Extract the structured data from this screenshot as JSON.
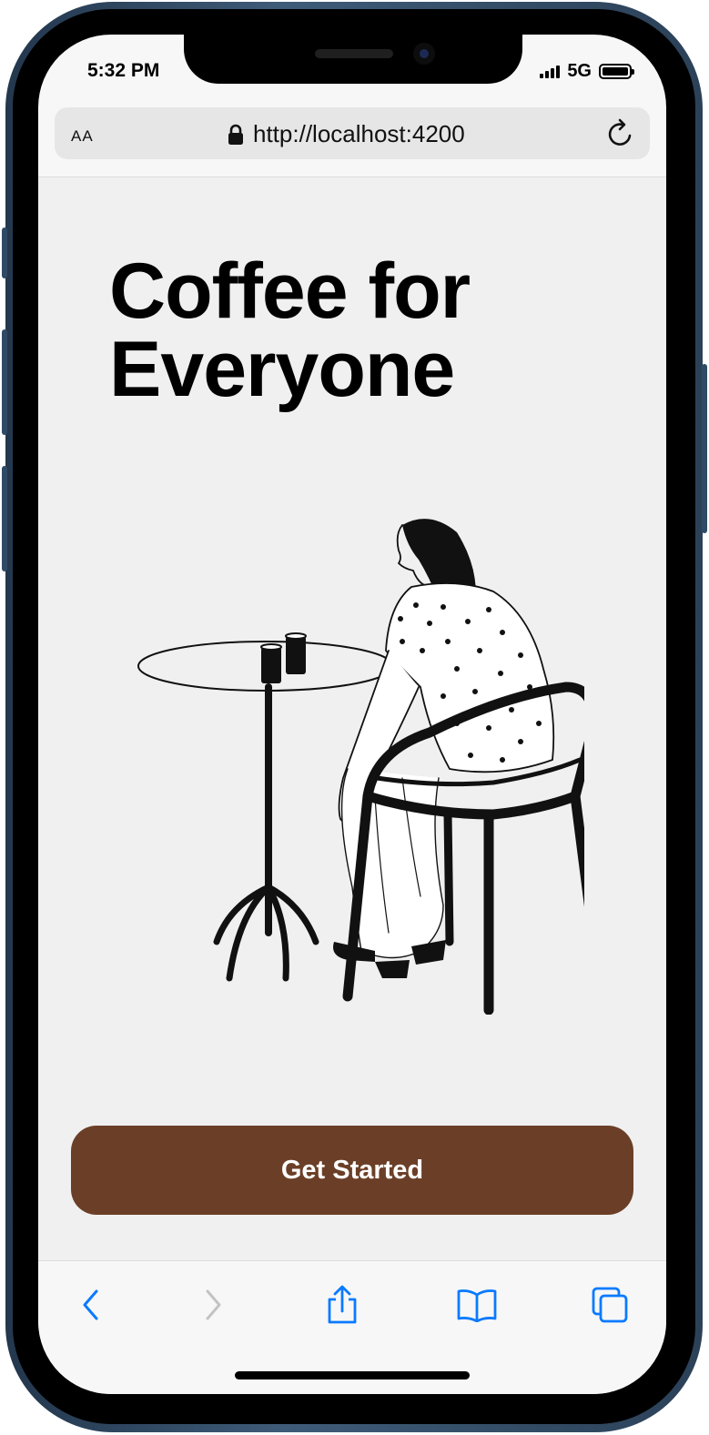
{
  "status_bar": {
    "time": "5:32 PM",
    "network": "5G"
  },
  "browser": {
    "text_size_label": "AA",
    "url": "http://localhost:4200",
    "icons": [
      "lock-icon",
      "reload-icon",
      "back-icon",
      "forward-icon",
      "share-icon",
      "bookmarks-icon",
      "tabs-icon"
    ]
  },
  "page": {
    "title_line1": "Coffee for",
    "title_line2": "Everyone",
    "cta_label": "Get Started"
  },
  "colors": {
    "cta_background": "#6b3f27",
    "page_background": "#f0f0f0",
    "ios_blue": "#0a7aff",
    "disabled_gray": "#c3c3c3"
  }
}
